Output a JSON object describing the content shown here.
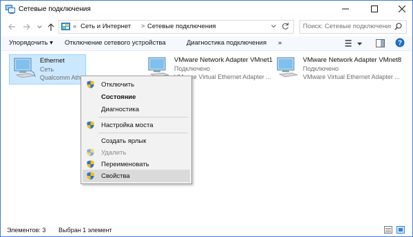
{
  "window": {
    "title": "Сетевые подключения",
    "controls": {
      "minimize": "–",
      "maximize": "☐",
      "close": "✕"
    }
  },
  "address_bar": {
    "prefix": "«",
    "crumbs": [
      "Сеть и Интернет",
      "Сетевые подключения"
    ],
    "separator": ">",
    "search_placeholder": "Поиск: Сетевые подключения"
  },
  "toolbar": {
    "organize": "Упорядочить ▾",
    "disable_device": "Отключение сетевого устройства",
    "diagnose": "Диагностика подключения",
    "more": "»"
  },
  "connections": [
    {
      "name": "Ethernet",
      "status": "Сеть",
      "device": "Qualcomm Ath",
      "selected": true
    },
    {
      "name": "VMware Network Adapter VMnet1",
      "status": "Подключено",
      "device": "VMware Virtual Ethernet Adapter ...",
      "selected": false
    },
    {
      "name": "VMware Network Adapter VMnet8",
      "status": "Подключено",
      "device": "VMware Virtual Ethernet Adapter ...",
      "selected": false
    }
  ],
  "context_menu": {
    "items": [
      {
        "label": "Отключить",
        "shield": true,
        "bold": false,
        "disabled": false
      },
      {
        "label": "Состояние",
        "shield": false,
        "bold": true,
        "disabled": false
      },
      {
        "label": "Диагностика",
        "shield": false,
        "bold": false,
        "disabled": false
      },
      {
        "label": "Настройка моста",
        "shield": true,
        "bold": false,
        "disabled": false
      },
      {
        "label": "Создать ярлык",
        "shield": false,
        "bold": false,
        "disabled": false
      },
      {
        "label": "Удалить",
        "shield": true,
        "bold": false,
        "disabled": true
      },
      {
        "label": "Переименовать",
        "shield": true,
        "bold": false,
        "disabled": false
      },
      {
        "label": "Свойства",
        "shield": true,
        "bold": false,
        "disabled": false,
        "highlighted": true
      }
    ]
  },
  "status_bar": {
    "items_count": "Элементов: 3",
    "selected": "Выбран 1 элемент"
  },
  "colors": {
    "accent": "#3b7fd1",
    "selection": "#cce8ff",
    "menu_bg": "#f2f2f2",
    "menu_highlight": "#dadada"
  }
}
